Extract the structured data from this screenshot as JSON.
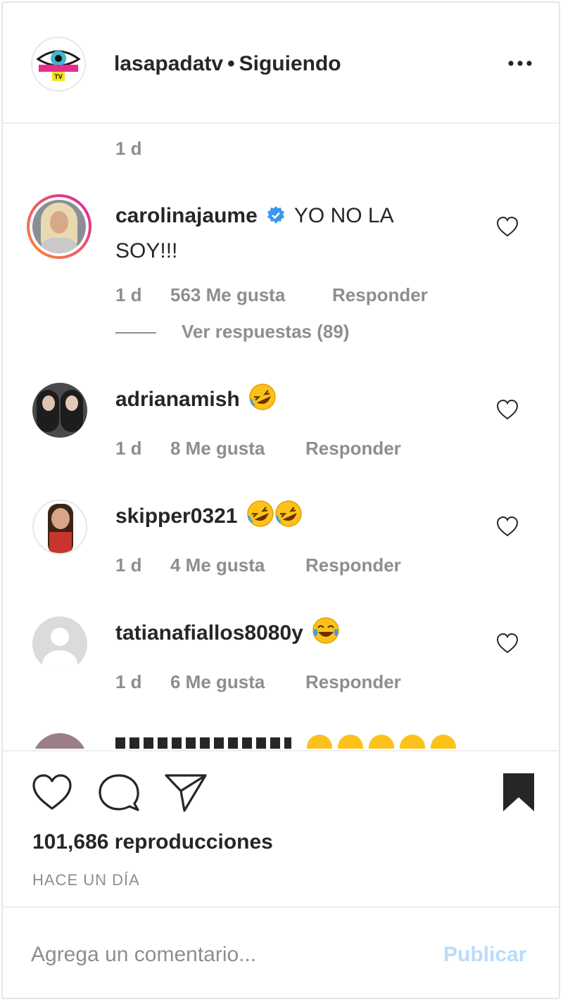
{
  "header": {
    "username": "lasapadatv",
    "separator": "•",
    "follow_status": "Siguiendo",
    "more_icon": "more-horizontal-icon",
    "avatar_logo_text": "LA SAPADA TV"
  },
  "caption": {
    "time": "1 d"
  },
  "comments": [
    {
      "user": "carolinajaume",
      "verified": true,
      "text": "YO NO LA SOY!!!",
      "time": "1 d",
      "likes": "563 Me gusta",
      "reply": "Responder",
      "view_replies": "Ver respuestas (89)"
    },
    {
      "user": "adrianamish",
      "text": "",
      "emojis": [
        "rolling-on-floor-laughing"
      ],
      "time": "1 d",
      "likes": "8 Me gusta",
      "reply": "Responder"
    },
    {
      "user": "skipper0321",
      "text": "",
      "emojis": [
        "rolling-on-floor-laughing",
        "rolling-on-floor-laughing"
      ],
      "time": "1 d",
      "likes": "4 Me gusta",
      "reply": "Responder"
    },
    {
      "user": "tatianafiallos8080y",
      "text": "",
      "emojis": [
        "tears-of-joy"
      ],
      "time": "1 d",
      "likes": "6 Me gusta",
      "reply": "Responder"
    }
  ],
  "actions": {
    "like_icon": "heart-icon",
    "comment_icon": "comment-bubble-icon",
    "share_icon": "paper-plane-icon",
    "save_icon": "bookmark-icon"
  },
  "views": "101,686 reproducciones",
  "posted": "HACE UN DÍA",
  "comment_box": {
    "placeholder": "Agrega un comentario...",
    "publish": "Publicar"
  },
  "colors": {
    "text": "#262626",
    "muted": "#8e8e8e",
    "verified": "#3897f0",
    "publish_disabled": "#b9dcfa",
    "story_ring_start": "#d6249f",
    "story_ring_end": "#fd8d32"
  }
}
